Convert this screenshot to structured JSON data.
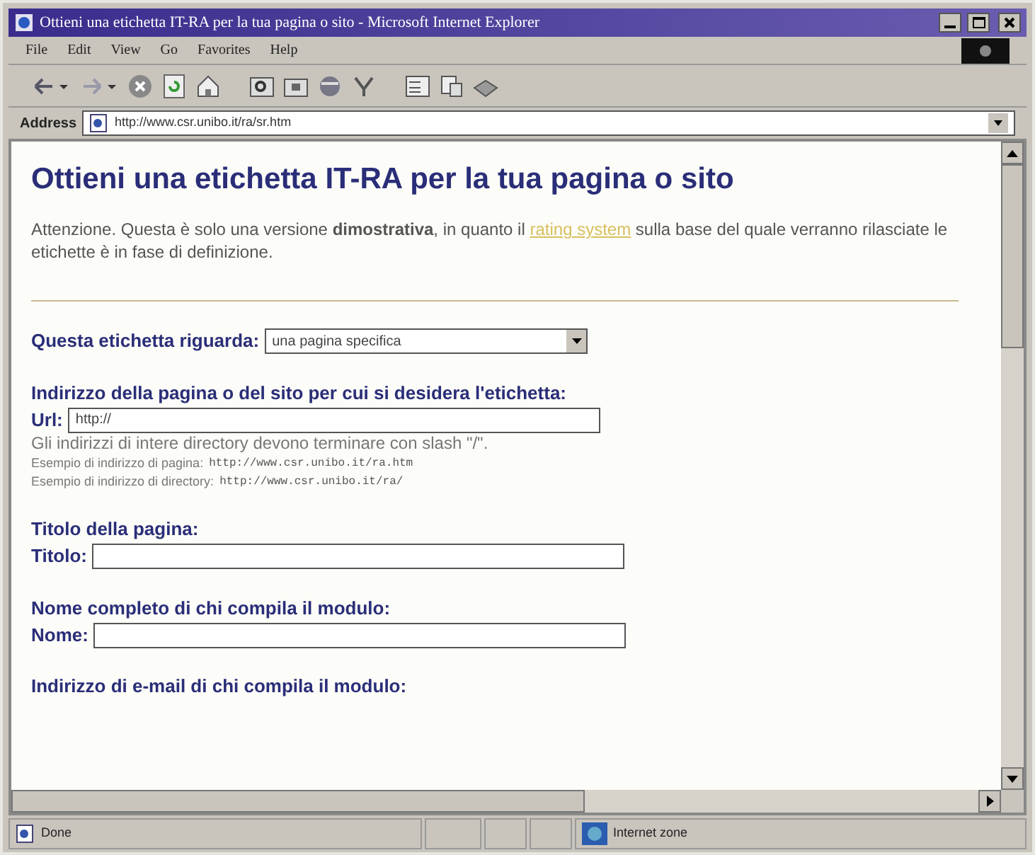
{
  "window": {
    "title": "Ottieni una etichetta IT-RA per la tua pagina o sito - Microsoft Internet Explorer"
  },
  "menu": [
    "File",
    "Edit",
    "View",
    "Go",
    "Favorites",
    "Help"
  ],
  "address_bar": {
    "label": "Address",
    "url": "http://www.csr.unibo.it/ra/sr.htm"
  },
  "page": {
    "heading": "Ottieni una etichetta IT-RA per la tua pagina o sito",
    "notice": {
      "before": "Attenzione. Questa è solo una versione **dimostrativa**, in quanto il",
      "link": "rating system",
      "after": "sulla base del quale verranno rilasciate le etichette è in fase di definizione."
    },
    "sections": [
      {
        "kind": "select",
        "label": "Questa etichetta riguarda:",
        "value": "una pagina specifica"
      },
      {
        "kind": "text",
        "heading": "Indirizzo della pagina o del sito per cui si desidera l'etichetta:",
        "label": "Url:",
        "value": "http://",
        "notes": [
          {
            "text": "Gli indirizzi di intere directory devono terminare con slash \"/\"."
          },
          {
            "text": "Esempio di indirizzo di pagina:",
            "code": "http://www.csr.unibo.it/ra.htm"
          },
          {
            "text": "Esempio di indirizzo di directory:",
            "code": "http://www.csr.unibo.it/ra/"
          }
        ]
      },
      {
        "kind": "text",
        "heading": "Titolo della pagina:",
        "label": "Titolo:"
      },
      {
        "kind": "text",
        "heading": "Nome completo di chi compila il modulo:",
        "label": "Nome:"
      },
      {
        "kind": "cut",
        "heading": "Indirizzo di e-mail di chi compila il modulo:"
      }
    ]
  },
  "status_bar": {
    "text": "Done",
    "zone": "Internet zone"
  }
}
